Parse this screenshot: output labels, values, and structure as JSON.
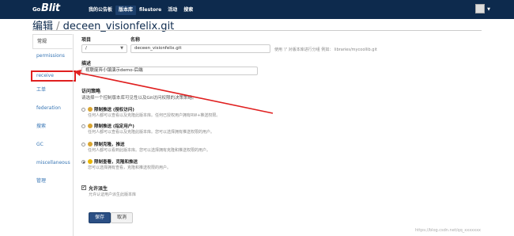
{
  "header": {
    "logo": "Blit",
    "logo_prefix": "Go",
    "nav": [
      {
        "label": "我的公告板"
      },
      {
        "label": "版本库"
      },
      {
        "label": "filestore"
      },
      {
        "label": "活动"
      },
      {
        "label": "搜索"
      }
    ],
    "active_nav_index": 1
  },
  "page": {
    "title_prefix": "编辑",
    "title_sep": " / ",
    "title_repo": "deceen_visionfelix.git"
  },
  "sidebar": {
    "items": [
      {
        "label": "常规"
      },
      {
        "label": "permissions"
      },
      {
        "label": "receive"
      },
      {
        "label": "工单"
      },
      {
        "label": "federation"
      },
      {
        "label": "搜索"
      },
      {
        "label": "GC"
      },
      {
        "label": "miscellaneous"
      },
      {
        "label": "管理"
      }
    ],
    "active_index": 0,
    "highlighted_index": 2
  },
  "form": {
    "project_label": "项目",
    "project_value": "/",
    "name_label": "名称",
    "name_value": "deceen_visionfelix.git",
    "name_hint": "使用 '/' 对版本库进行分组 例如： libraries/mycoollib.git",
    "desc_label": "描述",
    "desc_value": "视联废弃小镇演示demo-后端",
    "access_title": "访问策略",
    "access_subtitle": "请选择一个控制版本库可见性以及Git访问权限的决策策略。",
    "policies": [
      {
        "title": "限制推送 (授权访问)",
        "desc": "任何人都可以查看以及克隆此版本库。任何已授权用户拥有RW+推送权限。",
        "checked": false
      },
      {
        "title": "限制推送 (指定用户)",
        "desc": "任何人都可以查看以及克隆此版本库。您可以选择拥有推送权限的用户。",
        "checked": false
      },
      {
        "title": "限制克隆，推送",
        "desc": "任何人都可以看到此版本库。您可以选择拥有克隆和推送权限的用户。",
        "checked": false
      },
      {
        "title": "限制查看，克隆和推送",
        "desc": "您可以选择拥有查看，克隆和推送权限的用户。",
        "checked": true
      }
    ],
    "fork_label": "允许派生",
    "fork_desc": "允许认证用户派生此版本库",
    "fork_checked": "✔",
    "save_label": "保存",
    "cancel_label": "取消"
  },
  "watermark": "https://blog.csdn.net/qq_xxxxxxx",
  "colors": {
    "topbar": "#0d2a4d",
    "highlight_box": "#e02020",
    "arrow": "#e02020",
    "link": "#3876b5",
    "primary_button": "#2b4f84"
  },
  "icons": {
    "policy_icons": [
      "lock-icon",
      "lock-icon",
      "lock-icon",
      "key-icon"
    ],
    "avatar": "user-avatar-icon"
  }
}
